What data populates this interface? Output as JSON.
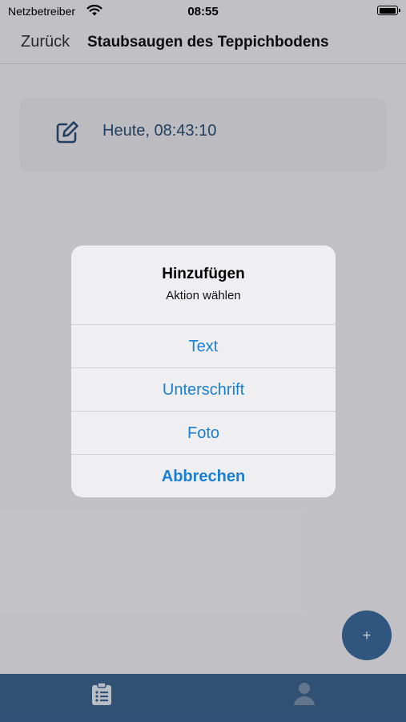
{
  "status_bar": {
    "carrier": "Netzbetreiber",
    "time": "08:55",
    "battery_level": 1.0
  },
  "nav": {
    "back_label": "Zurück",
    "title": "Staubsaugen des Teppichbodens"
  },
  "entries": [
    {
      "icon": "edit-icon",
      "timestamp": "Heute, 08:43:10"
    }
  ],
  "fab": {
    "label": "+",
    "icon": "plus-icon"
  },
  "tab_bar": {
    "items": [
      {
        "icon": "clipboard-list-icon",
        "selected": true
      },
      {
        "icon": "user-icon",
        "selected": false
      }
    ]
  },
  "alert": {
    "title": "Hinzufügen",
    "message": "Aktion wählen",
    "actions": [
      {
        "label": "Text"
      },
      {
        "label": "Unterschrift"
      },
      {
        "label": "Foto"
      },
      {
        "label": "Abbrechen",
        "style": "cancel"
      }
    ]
  },
  "colors": {
    "accent": "#1a7fd4",
    "tab_bar": "#3c6592",
    "fab": "#3d6b9f",
    "entry_text": "#2a4f7a"
  }
}
